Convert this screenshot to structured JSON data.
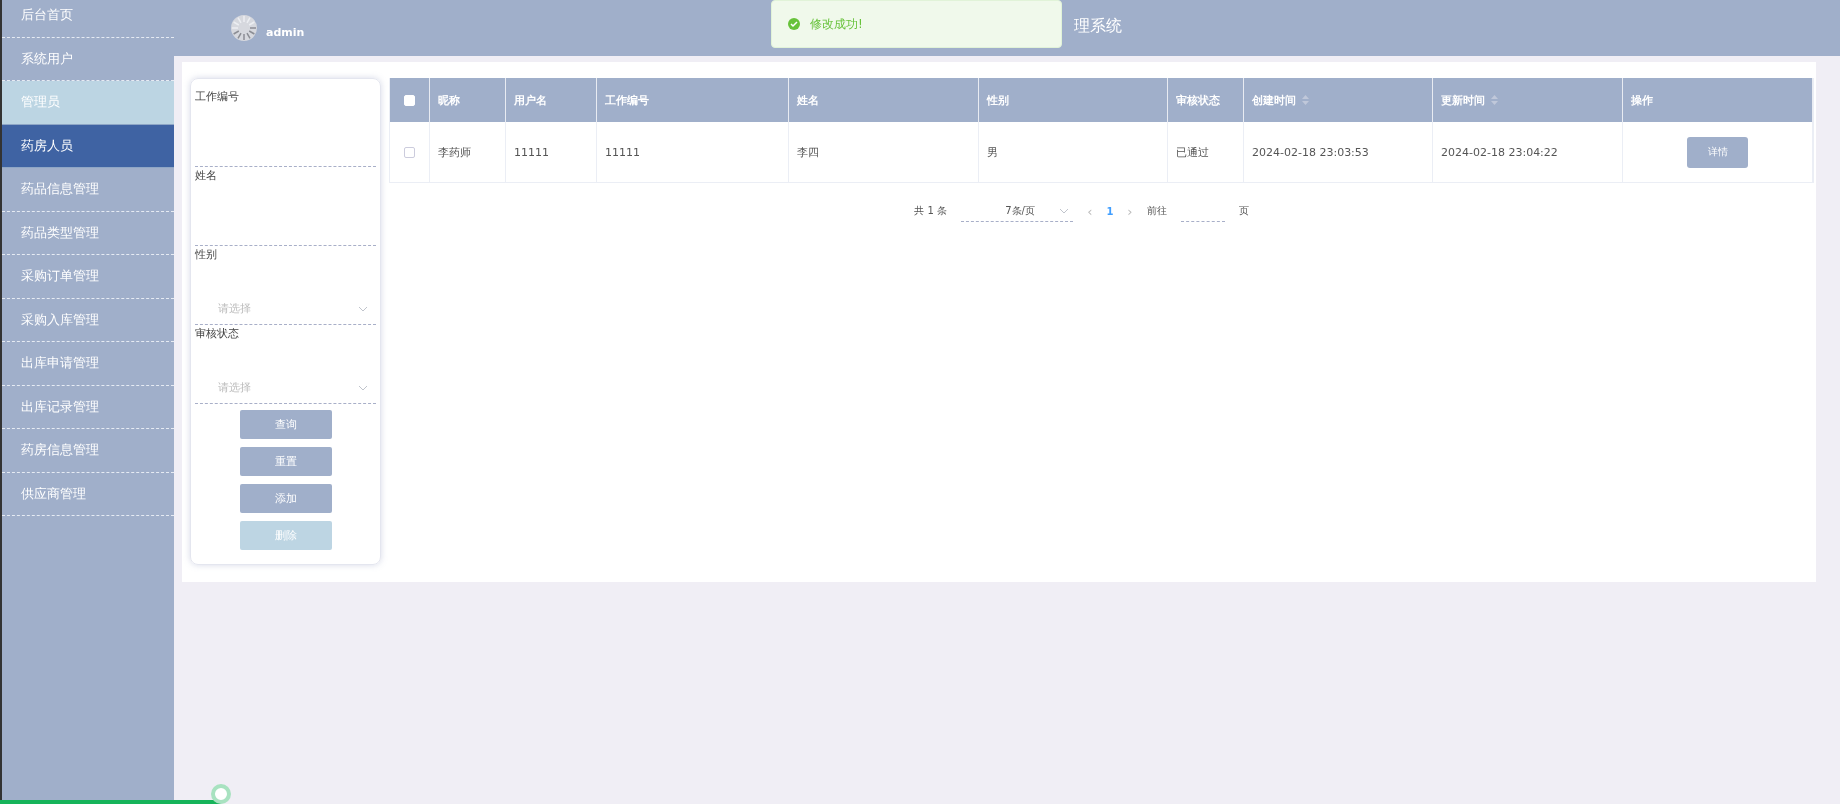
{
  "sidebar": {
    "items": [
      {
        "label": "后台首页",
        "selected": false,
        "hovered": false
      },
      {
        "label": "系统用户",
        "selected": false,
        "hovered": false
      },
      {
        "label": "管理员",
        "selected": false,
        "hovered": true
      },
      {
        "label": "药房人员",
        "selected": true,
        "hovered": false
      },
      {
        "label": "药品信息管理",
        "selected": false,
        "hovered": false
      },
      {
        "label": "药品类型管理",
        "selected": false,
        "hovered": false
      },
      {
        "label": "采购订单管理",
        "selected": false,
        "hovered": false
      },
      {
        "label": "采购入库管理",
        "selected": false,
        "hovered": false
      },
      {
        "label": "出库申请管理",
        "selected": false,
        "hovered": false
      },
      {
        "label": "出库记录管理",
        "selected": false,
        "hovered": false
      },
      {
        "label": "药房信息管理",
        "selected": false,
        "hovered": false
      },
      {
        "label": "供应商管理",
        "selected": false,
        "hovered": false
      }
    ]
  },
  "header": {
    "user": "admin",
    "title": "理系统"
  },
  "toast": {
    "message": "修改成功!"
  },
  "filters": [
    {
      "kind": "text",
      "label": "工作编号"
    },
    {
      "kind": "text",
      "label": "姓名"
    },
    {
      "kind": "select",
      "label": "性别",
      "placeholder": "请选择"
    },
    {
      "kind": "select",
      "label": "审核状态",
      "placeholder": "请选择"
    }
  ],
  "actions": [
    {
      "label": "查询",
      "disabled": false
    },
    {
      "label": "重置",
      "disabled": false
    },
    {
      "label": "添加",
      "disabled": false
    },
    {
      "label": "删除",
      "disabled": true
    }
  ],
  "table": {
    "columns": [
      {
        "label": "昵称",
        "sortable": false
      },
      {
        "label": "用户名",
        "sortable": false
      },
      {
        "label": "工作编号",
        "sortable": false
      },
      {
        "label": "姓名",
        "sortable": false
      },
      {
        "label": "性别",
        "sortable": false
      },
      {
        "label": "审核状态",
        "sortable": false
      },
      {
        "label": "创建时间",
        "sortable": true
      },
      {
        "label": "更新时间",
        "sortable": true
      },
      {
        "label": "操作",
        "sortable": false
      }
    ],
    "all_checked": false,
    "rows": [
      {
        "checked": false,
        "cells": [
          "李药师",
          "11111",
          "11111",
          "李四",
          "男",
          "已通过",
          "2024-02-18 23:03:53",
          "2024-02-18 23:04:22"
        ],
        "action": "详情"
      }
    ]
  },
  "pagination": {
    "total": "共 1 条",
    "page_size": "7条/页",
    "prev": "‹",
    "pages": [
      {
        "label": "1",
        "selected": true
      }
    ],
    "next": "›",
    "goto_label": "前往",
    "goto_suffix": "页"
  },
  "player": {
    "progress": {
      "level": 0.12
    }
  }
}
